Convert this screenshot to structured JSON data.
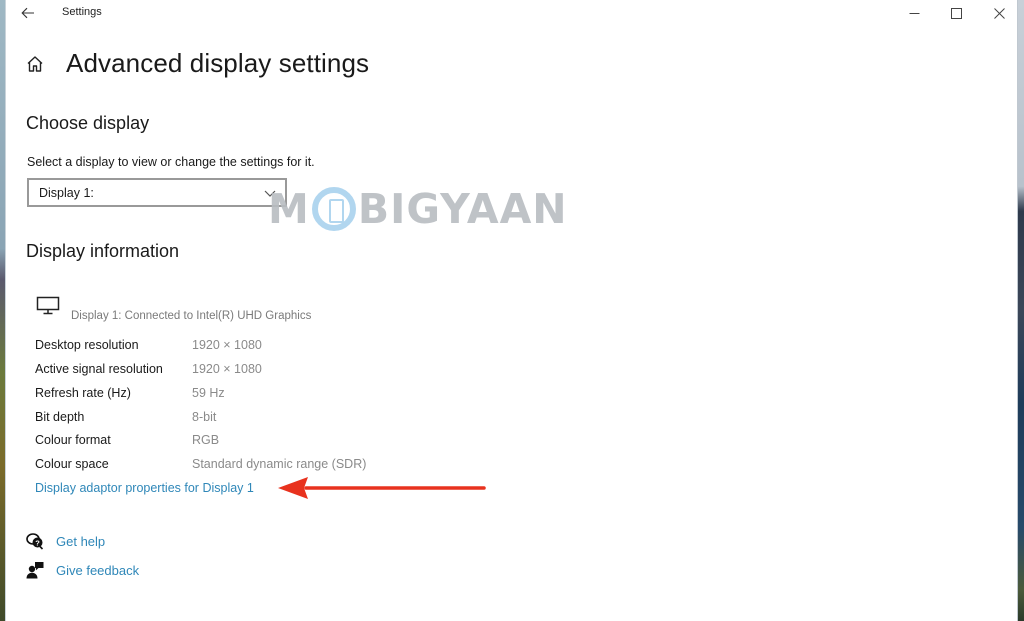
{
  "window": {
    "app_title": "Settings",
    "controls": {
      "back": "back-arrow-icon",
      "minimize": "minimize-icon",
      "maximize": "maximize-icon",
      "close": "close-icon"
    }
  },
  "header": {
    "home_icon": "home-icon",
    "title": "Advanced display settings"
  },
  "choose_display": {
    "title": "Choose display",
    "description": "Select a display to view or change the settings for it.",
    "select": {
      "selected": "Display 1:"
    }
  },
  "watermark": {
    "text_before": "M",
    "text_after": "BIGYAAN"
  },
  "display_information": {
    "title": "Display information",
    "monitor_icon": "monitor-icon",
    "connected": "Display 1: Connected to Intel(R) UHD Graphics",
    "rows": [
      {
        "label": "Desktop resolution",
        "value": "1920 × 1080"
      },
      {
        "label": "Active signal resolution",
        "value": "1920 × 1080"
      },
      {
        "label": "Refresh rate (Hz)",
        "value": "59 Hz"
      },
      {
        "label": "Bit depth",
        "value": "8-bit"
      },
      {
        "label": "Colour format",
        "value": "RGB"
      },
      {
        "label": "Colour space",
        "value": "Standard dynamic range (SDR)"
      }
    ],
    "adaptor_link": "Display adaptor properties for Display 1"
  },
  "annotation": {
    "arrow_color": "#e8321e"
  },
  "help": {
    "get_help": "Get help",
    "give_feedback": "Give feedback"
  },
  "colors": {
    "link": "#2f87b8",
    "value_text": "#8a8a8a"
  }
}
